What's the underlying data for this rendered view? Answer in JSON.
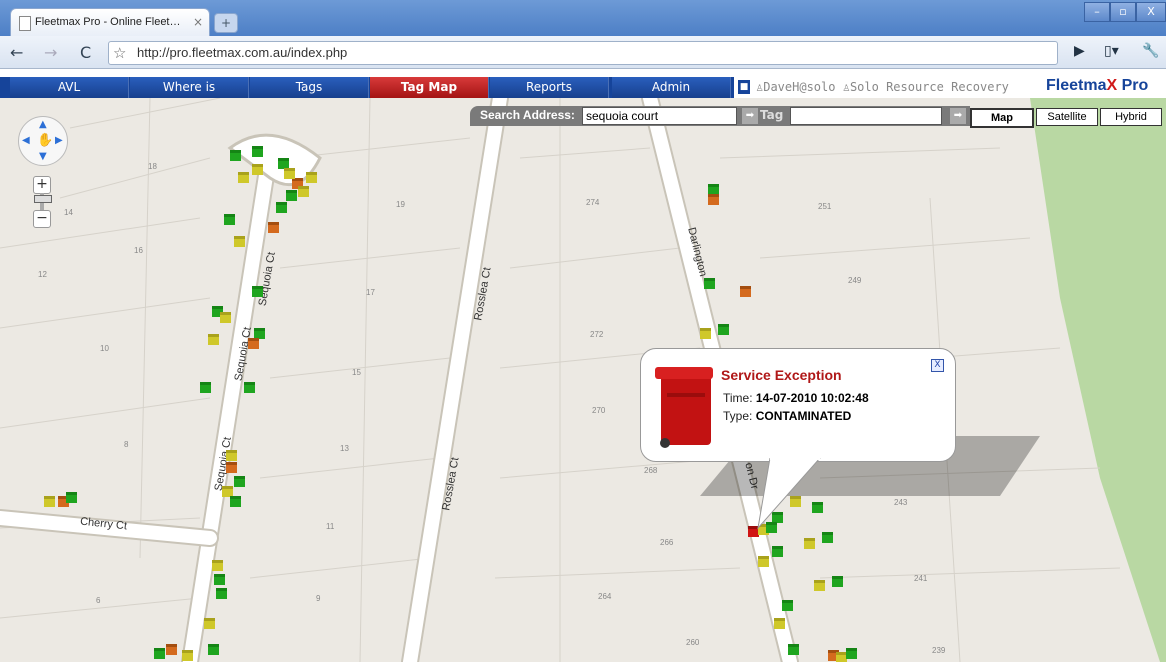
{
  "browser": {
    "tab_title": "Fleetmax Pro - Online Fleet…",
    "tab_close": "×",
    "new_tab": "+",
    "url": "http://pro.fleetmax.com.au/index.php",
    "min_btn": "–",
    "max_btn": "▫",
    "close_btn": "X"
  },
  "nav": {
    "items": [
      {
        "label": "AVL"
      },
      {
        "label": "Where is"
      },
      {
        "label": "Tags"
      },
      {
        "label": "Tag Map"
      },
      {
        "label": "Reports"
      },
      {
        "label": "Admin"
      }
    ],
    "active": "Tag Map",
    "user": "DaveH@solo",
    "company": "Solo Resource Recovery",
    "brand_pre": "Fleetma",
    "brand_x": "X",
    "brand_post": " Pro"
  },
  "search": {
    "label": "Search Address:",
    "value": "sequoia court",
    "tag_label": "Tag",
    "tag_value": ""
  },
  "map_types": [
    "Map",
    "Satellite",
    "Hybrid"
  ],
  "selected_map_type": "Map",
  "roads": [
    {
      "name": "Sequoia Ct"
    },
    {
      "name": "Sequoia Ct"
    },
    {
      "name": "Sequoia Ct"
    },
    {
      "name": "Rosslea Ct"
    },
    {
      "name": "Rosslea Ct"
    },
    {
      "name": "Cherry Ct"
    },
    {
      "name": "Darlington"
    },
    {
      "name": "on Dr"
    }
  ],
  "lots": [
    "18",
    "19",
    "14",
    "16",
    "17",
    "12",
    "10",
    "15",
    "8",
    "13",
    "11",
    "6",
    "9",
    "274",
    "251",
    "249",
    "272",
    "270",
    "268",
    "266",
    "264",
    "260",
    "243",
    "241",
    "239"
  ],
  "popup": {
    "title": "Service Exception",
    "time_label": "Time:",
    "time_value": "14-07-2010 10:02:48",
    "type_label": "Type:",
    "type_value": "CONTAMINATED",
    "close": "X"
  },
  "colors": {
    "nav_bg": "#16449a",
    "nav_active": "#c42020",
    "bin_green": "#1a9a1a",
    "bin_yellow": "#c9c21a",
    "bin_orange": "#d0661a",
    "bin_red": "#cc1111",
    "park_green": "#b8d8a0"
  }
}
